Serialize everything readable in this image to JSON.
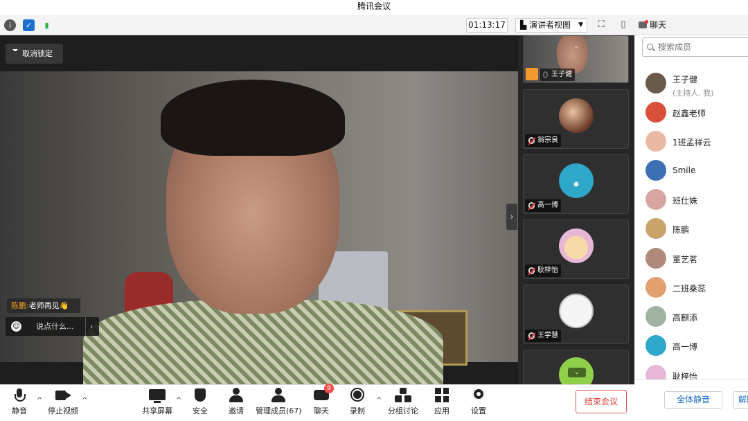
{
  "window": {
    "title": "腾讯会议"
  },
  "statusbar": {
    "timer": "01:13:17",
    "view_label": "演讲者视图",
    "icons": [
      "info-icon",
      "shield-icon",
      "signal-icon"
    ]
  },
  "main_video": {
    "unlock_label": "取消锁定",
    "chat_sender": "陈鹏:",
    "chat_message": "老师再见👋",
    "chat_placeholder": "说点什么..."
  },
  "video_strip": {
    "tiles": [
      {
        "name": "王子健",
        "avatar_color": "#8f8b86"
      },
      {
        "name": "翁宗良",
        "avatar_color": "#6b3a2a"
      },
      {
        "name": "高一博",
        "avatar_color": "#2fa7c9"
      },
      {
        "name": "耿梓怡",
        "avatar_color": "#e7b7d8"
      },
      {
        "name": "王学慧",
        "avatar_color": "#f0f0f0"
      },
      {
        "name": "",
        "avatar_color": "#8fcf4a"
      }
    ]
  },
  "chat_panel": {
    "title": "聊天",
    "search_placeholder": "搜索成员",
    "members": [
      {
        "name": "王子健",
        "sub": "(主持人, 我)",
        "color": "#6b5a4a"
      },
      {
        "name": "赵鑫老师",
        "sub": "",
        "color": "#d94f3a"
      },
      {
        "name": "1班孟祥云",
        "sub": "",
        "color": "#e9b9a4"
      },
      {
        "name": "Smile",
        "sub": "",
        "color": "#3d6fb4"
      },
      {
        "name": "班仕姝",
        "sub": "",
        "color": "#d9a5a0"
      },
      {
        "name": "陈鹏",
        "sub": "",
        "color": "#c9a46a"
      },
      {
        "name": "董艺茗",
        "sub": "",
        "color": "#b08a7a"
      },
      {
        "name": "二班桑蕊",
        "sub": "",
        "color": "#e2a070"
      },
      {
        "name": "高麒添",
        "sub": "",
        "color": "#9fb3a0"
      },
      {
        "name": "高一博",
        "sub": "",
        "color": "#2fa7c9"
      },
      {
        "name": "耿梓怡",
        "sub": "",
        "color": "#e7b7d8"
      }
    ],
    "mute_all": "全体静音",
    "unmute_all": "解除全体静音"
  },
  "toolbar": {
    "mute": "静音",
    "stop_video": "停止视频",
    "share_screen": "共享屏幕",
    "security": "安全",
    "invite": "邀请",
    "manage_members": "管理成员(67)",
    "chat": "聊天",
    "chat_badge": "9",
    "record": "录制",
    "breakout": "分组讨论",
    "apps": "应用",
    "settings": "设置",
    "end_meeting": "结束会议"
  }
}
